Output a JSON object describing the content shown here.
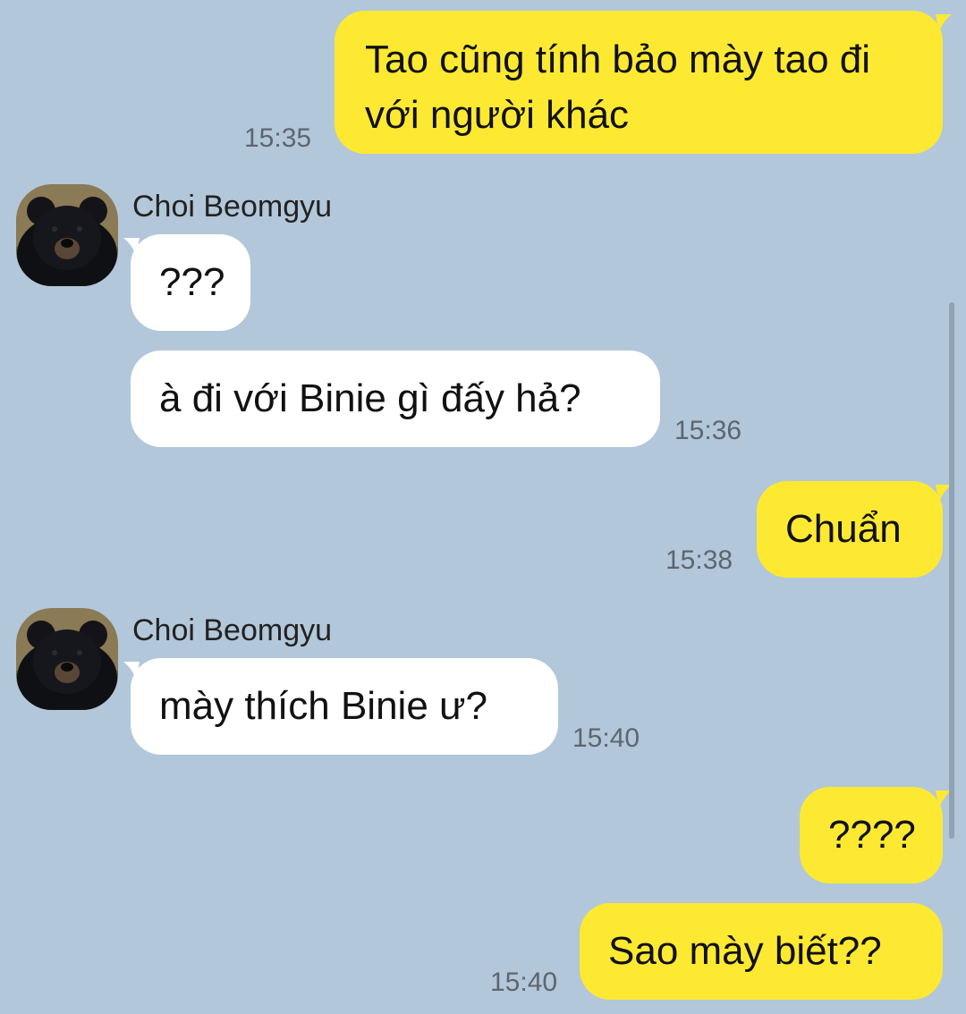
{
  "messages": [
    {
      "side": "me",
      "text": "Tao cũng tính bảo mày tao đi với người khác",
      "time": "15:35"
    },
    {
      "side": "them",
      "sender": "Choi Beomgyu",
      "avatar": "bear-avatar",
      "text": "???"
    },
    {
      "side": "them",
      "text": "à đi với Binie gì đấy hả?",
      "time": "15:36"
    },
    {
      "side": "me",
      "text": "Chuẩn",
      "time": "15:38"
    },
    {
      "side": "them",
      "sender": "Choi Beomgyu",
      "avatar": "bear-avatar",
      "text": "mày thích Binie ư?",
      "time": "15:40"
    },
    {
      "side": "me",
      "text": "????"
    },
    {
      "side": "me",
      "text": "Sao mày biết??",
      "time": "15:40"
    }
  ],
  "colors": {
    "background": "#b2c7d9",
    "my_bubble": "#fee932",
    "their_bubble": "#ffffff",
    "timestamp": "#5d6670"
  }
}
